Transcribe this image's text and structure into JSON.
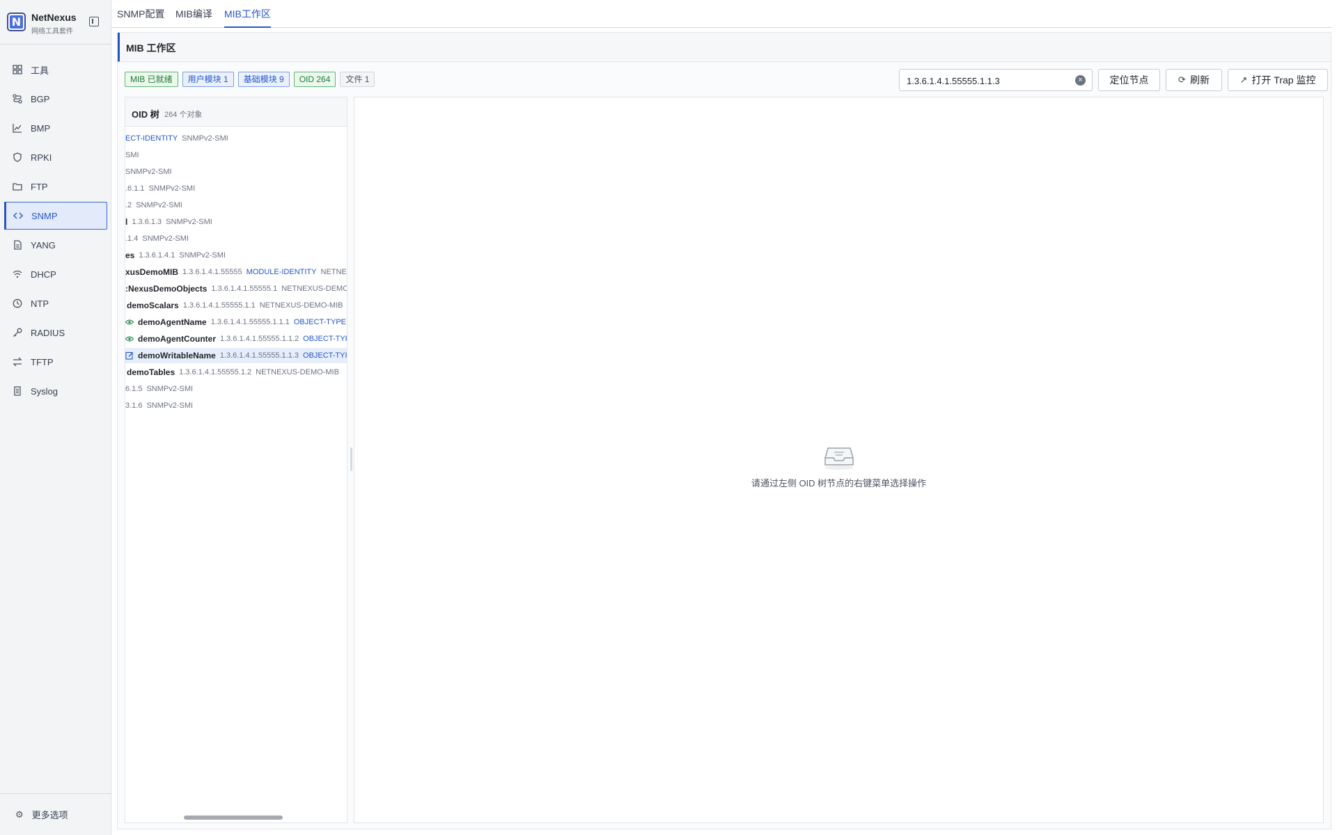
{
  "brand": {
    "name": "NetNexus",
    "subtitle": "网络工具套件",
    "logo_letter": "N"
  },
  "sidebar": {
    "items": [
      {
        "label": "工具",
        "icon": "grid-icon"
      },
      {
        "label": "BGP",
        "icon": "route-icon"
      },
      {
        "label": "BMP",
        "icon": "chart-icon"
      },
      {
        "label": "RPKI",
        "icon": "shield-icon"
      },
      {
        "label": "FTP",
        "icon": "folder-icon"
      },
      {
        "label": "SNMP",
        "icon": "code-icon",
        "active": true
      },
      {
        "label": "YANG",
        "icon": "document-icon"
      },
      {
        "label": "DHCP",
        "icon": "wifi-icon"
      },
      {
        "label": "NTP",
        "icon": "clock-icon"
      },
      {
        "label": "RADIUS",
        "icon": "key-icon"
      },
      {
        "label": "TFTP",
        "icon": "swap-icon"
      },
      {
        "label": "Syslog",
        "icon": "log-icon"
      }
    ],
    "more_label": "更多选项"
  },
  "tabs": [
    {
      "label": "SNMP配置"
    },
    {
      "label": "MIB编译"
    },
    {
      "label": "MIB工作区",
      "active": true
    }
  ],
  "panel": {
    "title": "MIB 工作区"
  },
  "badges": [
    {
      "label": "MIB 已就绪",
      "style": "green"
    },
    {
      "label": "用户模块 1",
      "style": "blue"
    },
    {
      "label": "基础模块 9",
      "style": "blue"
    },
    {
      "label": "OID 264",
      "style": "green"
    },
    {
      "label": "文件 1",
      "style": "gray"
    }
  ],
  "search": {
    "value": "1.3.6.1.4.1.55555.1.1.3",
    "placeholder": ""
  },
  "buttons": {
    "locate": "定位节点",
    "refresh": "刷新",
    "open_trap": "打开 Trap 监控"
  },
  "tree": {
    "title": "OID 树",
    "count": "264 个对象",
    "rows": [
      {
        "name": "",
        "oid": "",
        "type": "ECT-IDENTITY",
        "module": "SNMPv2-SMI",
        "icon": ""
      },
      {
        "name": "",
        "oid": "",
        "type": "",
        "module": "SMI",
        "icon": ""
      },
      {
        "name": "",
        "oid": "",
        "type": "",
        "module": "SNMPv2-SMI",
        "icon": ""
      },
      {
        "name": "",
        "oid": ".6.1.1",
        "type": "",
        "module": "SNMPv2-SMI",
        "icon": ""
      },
      {
        "name": "",
        "oid": ".2",
        "type": "",
        "module": "SNMPv2-SMI",
        "icon": ""
      },
      {
        "name": "l",
        "oid": "1.3.6.1.3",
        "type": "",
        "module": "SNMPv2-SMI",
        "icon": ""
      },
      {
        "name": "",
        "oid": ".1.4",
        "type": "",
        "module": "SNMPv2-SMI",
        "icon": ""
      },
      {
        "name": "es",
        "oid": "1.3.6.1.4.1",
        "type": "",
        "module": "SNMPv2-SMI",
        "icon": ""
      },
      {
        "name": "xusDemoMIB",
        "oid": "1.3.6.1.4.1.55555",
        "type": "MODULE-IDENTITY",
        "module": "NETNE",
        "icon": ""
      },
      {
        "name": ":NexusDemoObjects",
        "oid": "1.3.6.1.4.1.55555.1",
        "type": "",
        "module": "NETNEXUS-DEMO",
        "icon": ""
      },
      {
        "name": "demoScalars",
        "oid": "1.3.6.1.4.1.55555.1.1",
        "type": "",
        "module": "NETNEXUS-DEMO-MIB",
        "icon": ""
      },
      {
        "name": "demoAgentName",
        "oid": "1.3.6.1.4.1.55555.1.1.1",
        "type": "OBJECT-TYPE",
        "module": "",
        "icon": "eye-icon"
      },
      {
        "name": "demoAgentCounter",
        "oid": "1.3.6.1.4.1.55555.1.1.2",
        "type": "OBJECT-TYP",
        "module": "",
        "icon": "eye-icon"
      },
      {
        "name": "demoWritableName",
        "oid": "1.3.6.1.4.1.55555.1.1.3",
        "type": "OBJECT-TYI",
        "module": "",
        "icon": "edit-icon",
        "selected": true
      },
      {
        "name": "demoTables",
        "oid": "1.3.6.1.4.1.55555.1.2",
        "type": "",
        "module": "NETNEXUS-DEMO-MIB",
        "icon": ""
      },
      {
        "name": "",
        "oid": "6.1.5",
        "type": "",
        "module": "SNMPv2-SMI",
        "icon": ""
      },
      {
        "name": "",
        "oid": "3.1.6",
        "type": "",
        "module": "SNMPv2-SMI",
        "icon": ""
      }
    ]
  },
  "detail": {
    "empty_text": "请通过左侧 OID 树节点的右键菜单选择操作"
  }
}
